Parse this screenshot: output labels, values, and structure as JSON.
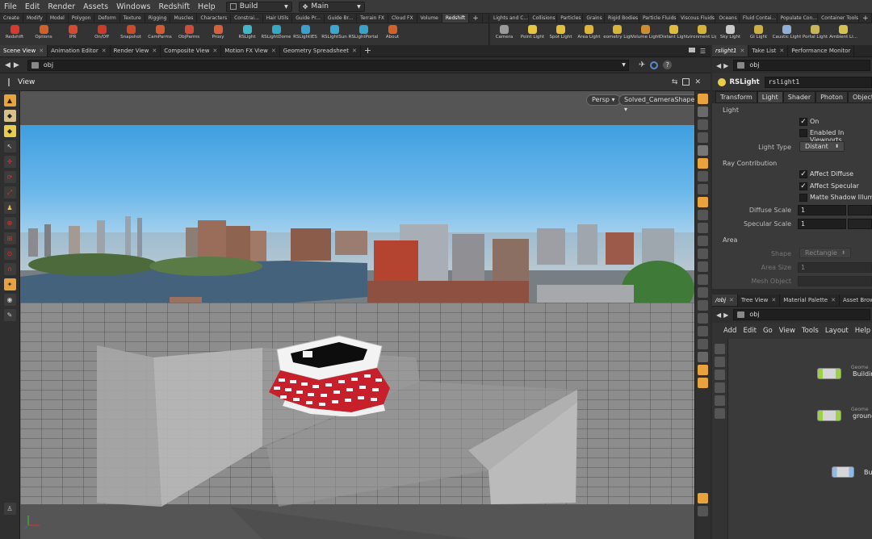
{
  "menubar": {
    "items": [
      "File",
      "Edit",
      "Render",
      "Assets",
      "Windows",
      "Redshift",
      "Help"
    ],
    "desktop": "Build",
    "scene": "Main"
  },
  "shelf_left": {
    "tabs": [
      "Create",
      "Modify",
      "Model",
      "Polygon",
      "Deform",
      "Texture",
      "Rigging",
      "Muscles",
      "Characters",
      "Constrai...",
      "Hair Utils",
      "Guide Pr...",
      "Guide Br...",
      "Terrain FX",
      "Cloud FX",
      "Volume",
      "Redshift"
    ],
    "active_tab": "Redshift",
    "tools": [
      {
        "label": "Redshift",
        "color": "#d63b2f"
      },
      {
        "label": "Options",
        "color": "#d0612b"
      },
      {
        "label": "IPR",
        "color": "#d64a2f"
      },
      {
        "label": "On/Off",
        "color": "#cc3a2a"
      },
      {
        "label": "Snapshot",
        "color": "#c94b2a"
      },
      {
        "label": "CamParms",
        "color": "#d45a30"
      },
      {
        "label": "ObjParms",
        "color": "#cf4d38"
      },
      {
        "label": "Proxy",
        "color": "#d6603a"
      },
      {
        "label": "RSLight",
        "color": "#3fb7c9"
      },
      {
        "label": "RSLightDome",
        "color": "#35a9c4"
      },
      {
        "label": "RSLightIES",
        "color": "#3b9fd0"
      },
      {
        "label": "RSLightSun",
        "color": "#3da6cf"
      },
      {
        "label": "RSLightPortal",
        "color": "#39a2c8"
      },
      {
        "label": "About",
        "color": "#d0612b"
      }
    ]
  },
  "shelf_right": {
    "tabs": [
      "Lights and C...",
      "Collisions",
      "Particles",
      "Grains",
      "Rigid Bodies",
      "Particle Fluids",
      "Viscous Fluids",
      "Oceans",
      "Fluid Contai...",
      "Populate Con...",
      "Container Tools"
    ],
    "tools": [
      {
        "label": "Camera",
        "color": "#9a9a9a"
      },
      {
        "label": "Point Light",
        "color": "#e6c640"
      },
      {
        "label": "Spot Light",
        "color": "#e1be3c"
      },
      {
        "label": "Area Light",
        "color": "#dcb53a"
      },
      {
        "label": "Geometry Light",
        "color": "#d9b438"
      },
      {
        "label": "Volume Light",
        "color": "#cc8e32"
      },
      {
        "label": "Distant Light",
        "color": "#e0bb3c"
      },
      {
        "label": "Environment Light",
        "color": "#d7b23a"
      },
      {
        "label": "Sky Light",
        "color": "#c9c9c9"
      },
      {
        "label": "GI Light",
        "color": "#cdb045"
      },
      {
        "label": "Caustic Light",
        "color": "#8fb0d6"
      },
      {
        "label": "Portal Light",
        "color": "#c8b45a"
      },
      {
        "label": "Ambient Li...",
        "color": "#d8c050"
      }
    ]
  },
  "pane_tabs": [
    "Scene View",
    "Animation Editor",
    "Render View",
    "Composite View",
    "Motion FX View",
    "Geometry Spreadsheet"
  ],
  "path": "obj",
  "viewport": {
    "title": "View",
    "persp_label": "Persp ▾",
    "camera_label": "Solved_CameraShape ▾"
  },
  "param_pane": {
    "tabs": [
      "rslight1",
      "Take List",
      "Performance Monitor"
    ],
    "path": "obj",
    "node_type": "RSLight",
    "node_name": "rslight1",
    "subtabs": [
      "Transform",
      "Light",
      "Shader",
      "Photon",
      "Objects"
    ],
    "active_subtab": "Light",
    "light_section": "Light",
    "on_label": "On",
    "enabled_in_viewports_label": "Enabled In Viewports",
    "light_type_label": "Light Type",
    "light_type_value": "Distant",
    "ray_section": "Ray Contribution",
    "affect_diffuse_label": "Affect Diffuse",
    "affect_specular_label": "Affect Specular",
    "matte_shadow_label": "Matte Shadow Illumina",
    "diffuse_scale_label": "Diffuse Scale",
    "diffuse_scale_value": "1",
    "specular_scale_label": "Specular Scale",
    "specular_scale_value": "1",
    "area_section": "Area",
    "shape_label": "Shape",
    "shape_value": "Rectangle",
    "area_size_label": "Area Size",
    "area_size_value": "1",
    "mesh_object_label": "Mesh Object"
  },
  "network_pane": {
    "tabs": [
      "/obj",
      "Tree View",
      "Material Palette",
      "Asset Brow"
    ],
    "path": "obj",
    "menu": [
      "Add",
      "Edit",
      "Go",
      "View",
      "Tools",
      "Layout",
      "Help"
    ],
    "nodes": [
      {
        "type": "Geome",
        "name": "Buildin"
      },
      {
        "type": "Geome",
        "name": "ground"
      },
      {
        "type": "",
        "name": "Bu"
      }
    ]
  },
  "colors": {
    "accent_orange": "#e8a33d",
    "brick_red": "#c8202a",
    "node_green": "#9bd04a"
  }
}
